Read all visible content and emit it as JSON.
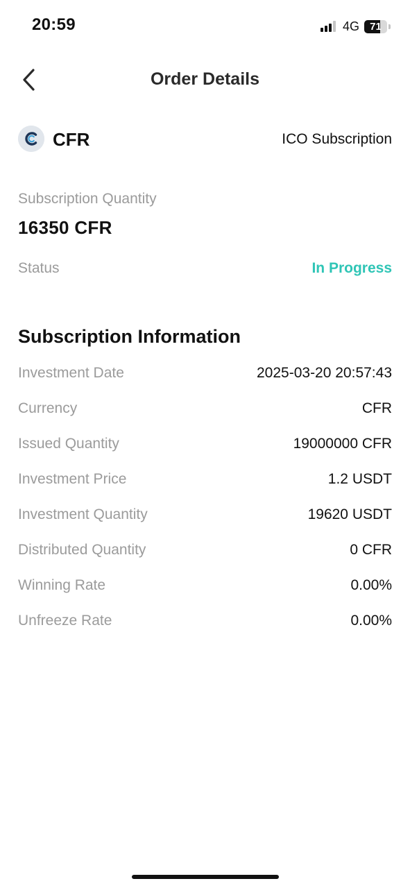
{
  "status_bar": {
    "time": "20:59",
    "network": "4G",
    "battery": "71",
    "battery_level": 0.71,
    "signal_bars": 3
  },
  "header": {
    "back_icon": "chevron-left-icon",
    "title": "Order Details"
  },
  "token": {
    "logo_icon": "cfr-logo-icon",
    "symbol": "CFR",
    "order_type": "ICO Subscription"
  },
  "subscription": {
    "quantity_label": "Subscription Quantity",
    "quantity_value": "16350 CFR",
    "status_label": "Status",
    "status_value": "In Progress"
  },
  "info": {
    "title": "Subscription Information",
    "rows": [
      {
        "label": "Investment Date",
        "value": "2025-03-20 20:57:43"
      },
      {
        "label": "Currency",
        "value": "CFR"
      },
      {
        "label": "Issued Quantity",
        "value": "19000000 CFR"
      },
      {
        "label": "Investment Price",
        "value": "1.2 USDT"
      },
      {
        "label": "Investment Quantity",
        "value": "19620 USDT"
      },
      {
        "label": "Distributed Quantity",
        "value": "0 CFR"
      },
      {
        "label": "Winning Rate",
        "value": "0.00%"
      },
      {
        "label": "Unfreeze Rate",
        "value": "0.00%"
      }
    ]
  },
  "colors": {
    "accent_status": "#2fc5b6",
    "label_gray": "#9b9b9b",
    "text_primary": "#111111"
  }
}
